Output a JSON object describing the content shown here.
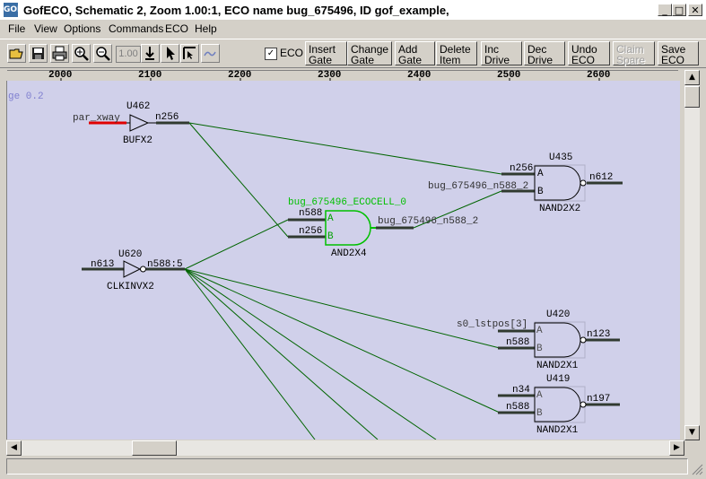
{
  "window": {
    "icon_label": "GOF",
    "title": "GofECO, Schematic 2, Zoom 1.00:1, ECO name bug_675496, ID gof_example,",
    "minimize": "_",
    "maximize": "□",
    "close": "✕"
  },
  "menu": [
    "File",
    "View",
    "Options",
    "Commands",
    "ECO",
    "Help"
  ],
  "toolbar": {
    "zoom_value": "1.00",
    "eco_checked": "✓",
    "eco_label": "ECO",
    "buttons": [
      {
        "line1": "Insert",
        "line2": "Gate"
      },
      {
        "line1": "Change",
        "line2": "Gate"
      },
      {
        "line1": "Add",
        "line2": "Gate"
      },
      {
        "line1": "Delete",
        "line2": "Item"
      },
      {
        "line1": "Inc",
        "line2": "Drive"
      },
      {
        "line1": "Dec",
        "line2": "Drive"
      },
      {
        "line1": "Undo",
        "line2": "ECO"
      },
      {
        "line1": "Claim",
        "line2": "Spare"
      },
      {
        "line1": "Save",
        "line2": "ECO"
      }
    ],
    "icons": [
      "open-icon",
      "save-icon",
      "print-icon",
      "zoom-in-icon",
      "zoom-out-icon",
      "download-icon",
      "pointer-icon",
      "select-icon",
      "wave-icon"
    ]
  },
  "ruler": [
    "2000",
    "2100",
    "2200",
    "2300",
    "2400",
    "2500",
    "2600"
  ],
  "schematic": {
    "page_label": "ge 0.2",
    "highlight_color": "#00c000",
    "wire_color": "#006400",
    "gates": {
      "u462": {
        "instance": "U462",
        "cell": "BUFX2",
        "in_net": "par_xway",
        "out_net": "n256"
      },
      "u620": {
        "instance": "U620",
        "cell": "CLKINVX2",
        "in_net": "n613",
        "out_net": "n588:5"
      },
      "eco": {
        "instance": "bug_675496_ECOCELL_0",
        "cell": "AND2X4",
        "pin_a_net": "n588",
        "pin_b_net": "n256",
        "out_net": "bug_675496_n588_2",
        "pin_a": "A",
        "pin_b": "B"
      },
      "u435": {
        "instance": "U435",
        "cell": "NAND2X2",
        "pin_a_net": "n256",
        "pin_b_net": "bug_675496_n588_2",
        "out_net": "n612",
        "pin_a": "A",
        "pin_b": "B"
      },
      "u420": {
        "instance": "U420",
        "cell": "NAND2X1",
        "pin_a_net": "s0_lstpos[3]",
        "pin_b_net": "n588",
        "out_net": "n123",
        "pin_a": "A",
        "pin_b": "B"
      },
      "u419": {
        "instance": "U419",
        "cell": "NAND2X1",
        "pin_a_net": "n34",
        "pin_b_net": "n588",
        "out_net": "n197",
        "pin_a": "A",
        "pin_b": "B"
      }
    }
  },
  "scrollbars": {
    "up": "▲",
    "down": "▼",
    "left": "◀",
    "right": "▶"
  }
}
